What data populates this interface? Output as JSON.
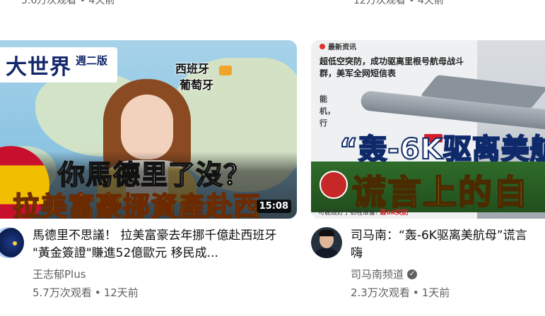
{
  "top_fragments": {
    "left": "5.6万次观看 • 4天前",
    "right": "12万次观看 • 4天前"
  },
  "videos": [
    {
      "thumbnail": {
        "show_title": "大世界",
        "show_sub": "週二版",
        "label_spain": "西班牙",
        "label_portugal": "葡萄牙",
        "caption_line1": "你馬德里了沒？",
        "caption_line2": "拉美富豪挪資產赴西",
        "duration": "15:08"
      },
      "title": "馬德里不思議！ 拉美富豪去年挪千億赴西班牙 \"黃金簽證\"賺進52億歐元 移民成...",
      "channel": "王志郁Plus",
      "views": "5.7万次观看",
      "age": "12天前"
    },
    {
      "thumbnail": {
        "tag": "最新资讯",
        "headline": "超低空突防，成功驱离里根号航母战斗群，美军全网短信表",
        "fragment1": "能",
        "fragment2": "机，",
        "fragment3": "行",
        "big_line1": "“轰-6K驱离美航",
        "big_line2": "谎言上的自",
        "footer_prefix": "可能做好了牺牲准备!",
        "footer_red": "轰6K突防"
      },
      "title_line1": "司马南：“轰-6K驱离美航母”谎言",
      "title_line2": "嗨",
      "channel": "司马南频道",
      "views": "2.3万次观看",
      "age": "1天前"
    }
  ],
  "icons": {
    "verified": "verified-check-icon"
  }
}
